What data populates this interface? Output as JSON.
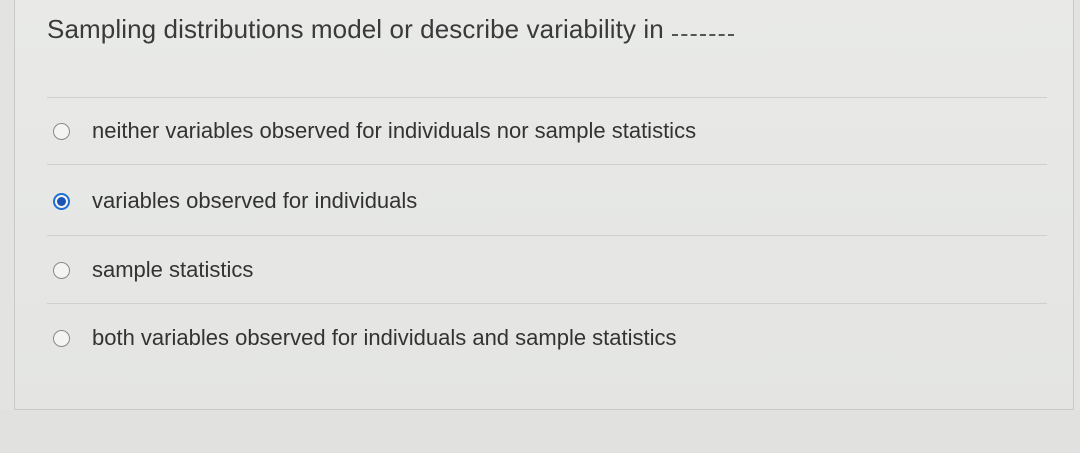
{
  "question": {
    "text": "Sampling distributions model or describe variability in",
    "blank": ""
  },
  "options": [
    {
      "label": "neither variables observed for individuals nor sample statistics",
      "selected": false
    },
    {
      "label": "variables observed for individuals",
      "selected": true
    },
    {
      "label": "sample statistics",
      "selected": false
    },
    {
      "label": "both variables observed for individuals and sample statistics",
      "selected": false
    }
  ],
  "colors": {
    "accent": "#1b53b8",
    "background": "#e6e7e5",
    "text": "#333333"
  }
}
